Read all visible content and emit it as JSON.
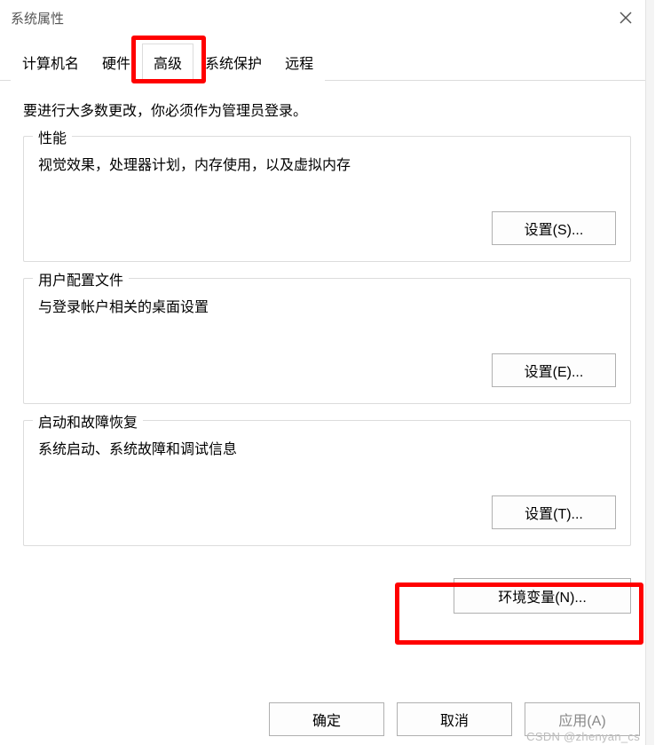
{
  "dialog": {
    "title": "系统属性"
  },
  "tabs": {
    "computer_name": "计算机名",
    "hardware": "硬件",
    "advanced": "高级",
    "system_protection": "系统保护",
    "remote": "远程"
  },
  "content": {
    "intro": "要进行大多数更改，你必须作为管理员登录。",
    "performance": {
      "title": "性能",
      "desc": "视觉效果，处理器计划，内存使用，以及虚拟内存",
      "button": "设置(S)..."
    },
    "user_profiles": {
      "title": "用户配置文件",
      "desc": "与登录帐户相关的桌面设置",
      "button": "设置(E)..."
    },
    "startup": {
      "title": "启动和故障恢复",
      "desc": "系统启动、系统故障和调试信息",
      "button": "设置(T)..."
    },
    "env_button": "环境变量(N)..."
  },
  "footer": {
    "ok": "确定",
    "cancel": "取消",
    "apply": "应用(A)"
  },
  "watermark": "CSDN @zhenyan_cs"
}
